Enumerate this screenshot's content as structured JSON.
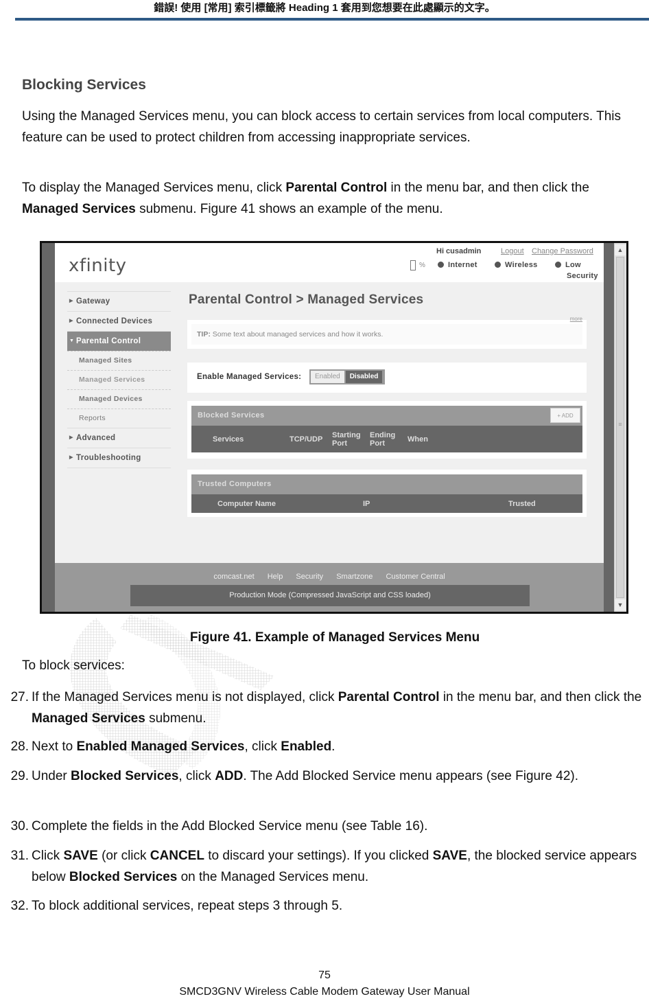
{
  "header": {
    "error_text": "錯誤! 使用 [常用] 索引標籤將 Heading 1 套用到您想要在此處顯示的文字。",
    "rule_color": "#2e5a86"
  },
  "section": {
    "heading": "Blocking Services",
    "para1": "Using the Managed Services menu, you can block access to certain services from local computers. This feature can be used to protect children from accessing inappropriate services.",
    "para2": {
      "a": "To display the Managed Services menu, click ",
      "b1": "Parental Control",
      "c": " in the menu bar, and then click the ",
      "b2": "Managed Services",
      "d": " submenu. Figure 41 shows an example of the menu."
    }
  },
  "figure": {
    "logo": "xfinity",
    "user": {
      "greeting": "Hi cusadmin",
      "logout": "Logout",
      "change_password": "Change Password"
    },
    "status": {
      "battery_pct": "%",
      "internet": "Internet",
      "wireless": "Wireless",
      "security_a": "Low",
      "security_b": "Security"
    },
    "nav": {
      "items": [
        {
          "label": "Gateway"
        },
        {
          "label": "Connected Devices"
        },
        {
          "label": "Parental Control"
        },
        {
          "label": "Advanced"
        },
        {
          "label": "Troubleshooting"
        }
      ],
      "sub_items": [
        {
          "label": "Managed Sites"
        },
        {
          "label": "Managed Services"
        },
        {
          "label": "Managed Devices"
        },
        {
          "label": "Reports"
        }
      ]
    },
    "page_title": "Parental Control > Managed Services",
    "tip": {
      "label": "TIP:",
      "text": " Some text about managed services and how it works.",
      "more": "more"
    },
    "enable": {
      "label": "Enable Managed Services:",
      "enabled": "Enabled",
      "disabled": "Disabled",
      "selected": "Disabled"
    },
    "blocked": {
      "title": "Blocked Services",
      "add": "+ ADD",
      "columns": [
        "Services",
        "TCP/UDP",
        "Starting Port",
        "Ending Port",
        "When"
      ]
    },
    "trusted": {
      "title": "Trusted Computers",
      "columns": [
        "Computer Name",
        "IP",
        "Trusted"
      ]
    },
    "footer_links": [
      "comcast.net",
      "Help",
      "Security",
      "Smartzone",
      "Customer Central"
    ],
    "production_mode": "Production Mode (Compressed JavaScript and CSS loaded)"
  },
  "caption": "Figure 41. Example of Managed Services Menu",
  "intro": "To block services:",
  "steps": [
    {
      "num": "27.",
      "parts": [
        [
          "If the Managed Services menu is not displayed, click ",
          false
        ],
        [
          "Parental Control",
          true
        ],
        [
          " in the menu bar, and then click the ",
          false
        ],
        [
          "Managed Services",
          true
        ],
        [
          " submenu.",
          false
        ]
      ]
    },
    {
      "num": "28.",
      "parts": [
        [
          "Next to ",
          false
        ],
        [
          "Enabled Managed Services",
          true
        ],
        [
          ", click ",
          false
        ],
        [
          "Enabled",
          true
        ],
        [
          ".",
          false
        ]
      ]
    },
    {
      "num": "29.",
      "parts": [
        [
          "Under ",
          false
        ],
        [
          "Blocked Services",
          true
        ],
        [
          ", click ",
          false
        ],
        [
          "ADD",
          true
        ],
        [
          ". The Add Blocked Service menu appears (see Figure 42).",
          false
        ]
      ]
    },
    {
      "num": "30.",
      "parts": [
        [
          "Complete the fields in the Add Blocked Service menu (see Table 16).",
          false
        ]
      ]
    },
    {
      "num": "31.",
      "parts": [
        [
          "Click ",
          false
        ],
        [
          "SAVE",
          true
        ],
        [
          " (or click ",
          false
        ],
        [
          "CANCEL",
          true
        ],
        [
          " to discard your settings). If you clicked ",
          false
        ],
        [
          "SAVE",
          true
        ],
        [
          ", the blocked service appears below ",
          false
        ],
        [
          "Blocked Services",
          true
        ],
        [
          " on the Managed Services menu.",
          false
        ]
      ]
    },
    {
      "num": "32.",
      "parts": [
        [
          "To block additional services, repeat steps 3 through 5.",
          false
        ]
      ]
    }
  ],
  "page_number": "75",
  "manual_title": "SMCD3GNV Wireless Cable Modem Gateway User Manual"
}
